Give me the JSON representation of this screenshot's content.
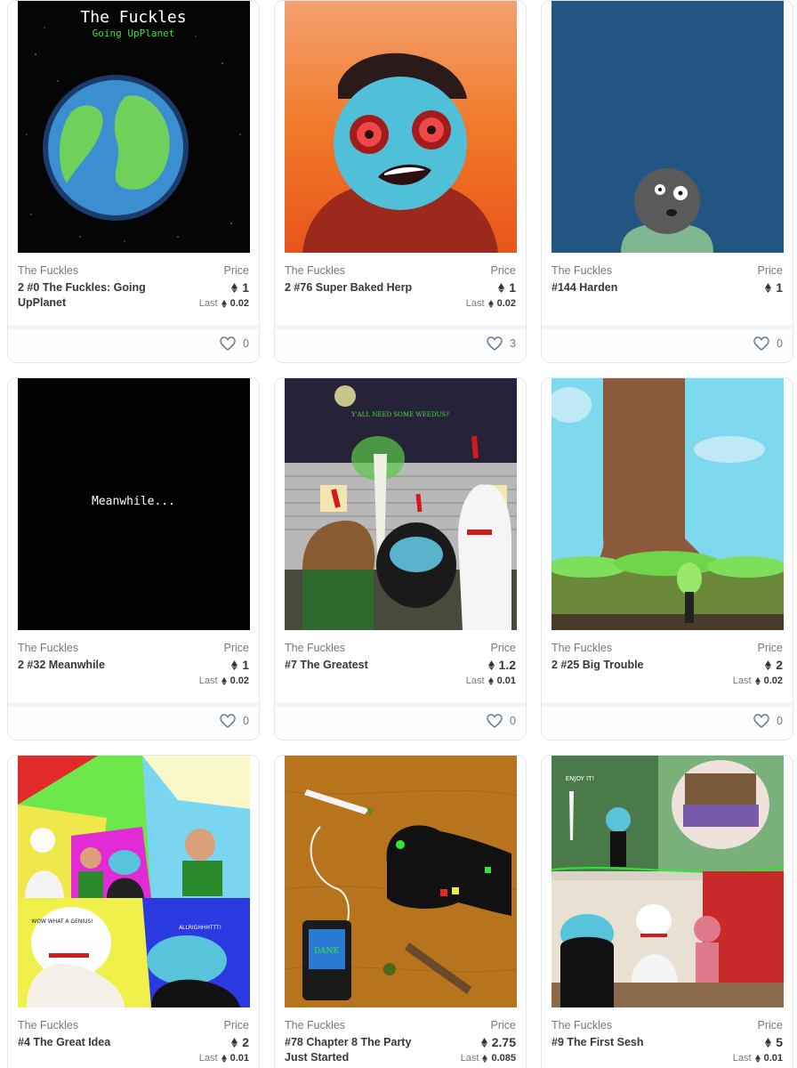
{
  "cards": [
    {
      "collection": "The Fuckles",
      "title": "2 #0 The Fuckles: Going UpPlanet",
      "price_label": "Price",
      "price": "1",
      "last_label": "Last",
      "last": "0.02",
      "likes": "0",
      "art_title": "The Fuckles",
      "art_subtitle": "Going UpPlanet"
    },
    {
      "collection": "The Fuckles",
      "title": "2 #76 Super Baked Herp",
      "price_label": "Price",
      "price": "1",
      "last_label": "Last",
      "last": "0.02",
      "likes": "3"
    },
    {
      "collection": "The Fuckles",
      "title": "#144 Harden",
      "price_label": "Price",
      "price": "1",
      "last_label": "",
      "last": "",
      "likes": "0"
    },
    {
      "collection": "The Fuckles",
      "title": "2 #32 Meanwhile",
      "price_label": "Price",
      "price": "1",
      "last_label": "Last",
      "last": "0.02",
      "likes": "0",
      "art_text": "Meanwhile..."
    },
    {
      "collection": "The Fuckles",
      "title": "#7 The Greatest",
      "price_label": "Price",
      "price": "1.2",
      "last_label": "Last",
      "last": "0.01",
      "likes": "0",
      "art_text": "Y'ALL NEED SOME WEEDUS?"
    },
    {
      "collection": "The Fuckles",
      "title": "2 #25 Big Trouble",
      "price_label": "Price",
      "price": "2",
      "last_label": "Last",
      "last": "0.02",
      "likes": "0"
    },
    {
      "collection": "The Fuckles",
      "title": "#4 The Great Idea",
      "price_label": "Price",
      "price": "2",
      "last_label": "Last",
      "last": "0.01",
      "likes": "",
      "art_text": "WOW WHAT A GENIUS!",
      "art_text2": "ALLRIGHHHTTT!"
    },
    {
      "collection": "The Fuckles",
      "title": "#78 Chapter 8 The Party Just Started",
      "price_label": "Price",
      "price": "2.75",
      "last_label": "Last",
      "last": "0.085",
      "likes": "",
      "art_text": "DANK"
    },
    {
      "collection": "The Fuckles",
      "title": "#9 The First Sesh",
      "price_label": "Price",
      "price": "5",
      "last_label": "Last",
      "last": "0.01",
      "likes": "",
      "art_text": "ENJOY IT!"
    }
  ],
  "icons": {
    "currency": "ethereum-icon",
    "like": "heart-icon"
  },
  "colors": {
    "border": "#e5e8eb",
    "muted": "#707a83",
    "text": "#353840"
  }
}
